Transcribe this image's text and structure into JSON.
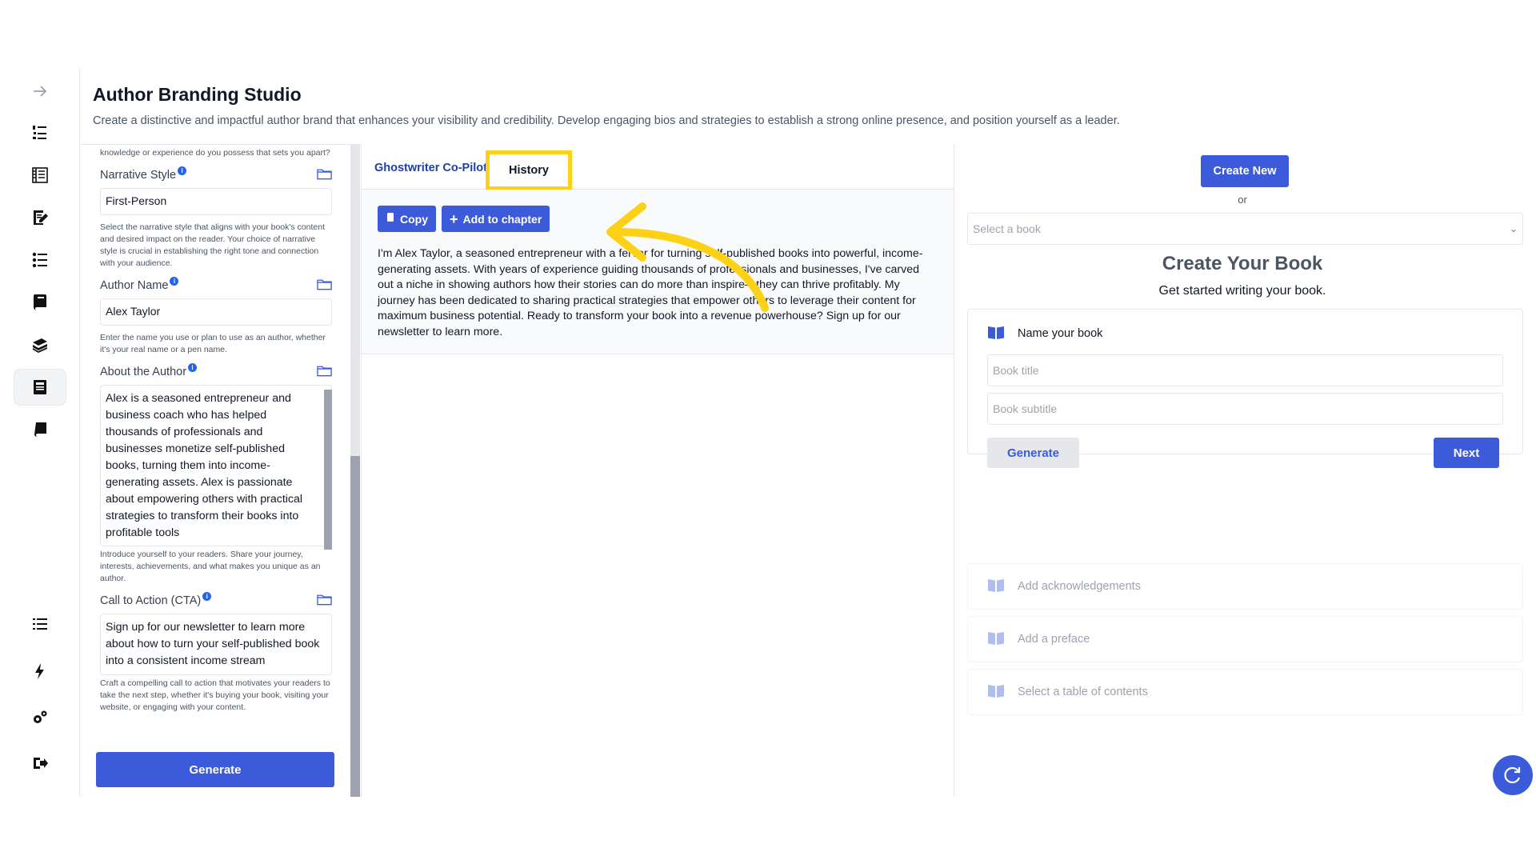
{
  "header": {
    "title": "Author Branding Studio",
    "description": "Create a distinctive and impactful author brand that enhances your visibility and credibility. Develop engaging bios and strategies to establish a strong online presence, and position yourself as a leader."
  },
  "nav": {
    "items": [
      "collapse-arrow-icon",
      "outline-list-icon",
      "book-layout-icon",
      "edit-document-icon",
      "numbered-list-icon",
      "notebook-icon",
      "books-icon",
      "author-branding-icon",
      "book-closed-icon",
      "menu-list-icon",
      "lightning-icon",
      "settings-gear-icon",
      "logout-icon"
    ],
    "active": "author-branding-icon"
  },
  "form": {
    "top_helper": "knowledge or experience do you possess that sets you apart?",
    "narrative_style": {
      "label": "Narrative Style",
      "value": "First-Person",
      "helper": "Select the narrative style that aligns with your book's content and desired impact on the reader. Your choice of narrative style is crucial in establishing the right tone and connection with your audience."
    },
    "author_name": {
      "label": "Author Name",
      "value": "Alex Taylor",
      "helper": "Enter the name you use or plan to use as an author, whether it's your real name or a pen name."
    },
    "about_author": {
      "label": "About the Author",
      "value": "Alex is a seasoned entrepreneur and business coach who has helped thousands of professionals and businesses monetize self-published books, turning them into income-generating assets. Alex is passionate about empowering others with practical strategies to transform their books into profitable tools",
      "helper": "Introduce yourself to your readers. Share your journey, interests, achievements, and what makes you unique as an author."
    },
    "cta": {
      "label": "Call to Action (CTA)",
      "value": "Sign up for our newsletter to learn more about how to turn your self-published book into a consistent income stream",
      "helper": "Craft a compelling call to action that motivates your readers to take the next step, whether it's buying your book, visiting your website, or engaging with your content."
    },
    "generate_label": "Generate"
  },
  "middle": {
    "tab_copilot": "Ghostwriter Co-Pilot",
    "tab_history": "History",
    "copy_label": "Copy",
    "add_chapter_label": "Add to chapter",
    "output": "I'm Alex Taylor, a seasoned entrepreneur with a fervor for turning self-published books into powerful, income-generating assets. With years of experience guiding thousands of professionals and businesses, I've carved out a niche in showing authors how their stories can do more than inspire—they can thrive profitably. My journey has been dedicated to sharing practical strategies that empower others to leverage their content for maximum business potential. Ready to transform your book into a revenue powerhouse? Sign up for our newsletter to learn more."
  },
  "right": {
    "create_new": "Create New",
    "or": "or",
    "select_placeholder": "Select a book",
    "title": "Create Your Book",
    "subtitle": "Get started writing your book.",
    "card_heading": "Name your book",
    "book_title_placeholder": "Book title",
    "book_subtitle_placeholder": "Book subtitle",
    "generate_label": "Generate",
    "next_label": "Next",
    "steps": [
      "Add acknowledgements",
      "Add a preface",
      "Select a table of contents"
    ]
  },
  "colors": {
    "primary": "#3b5bdb",
    "highlight": "#fcd116",
    "tab_active": "#1e40af"
  }
}
